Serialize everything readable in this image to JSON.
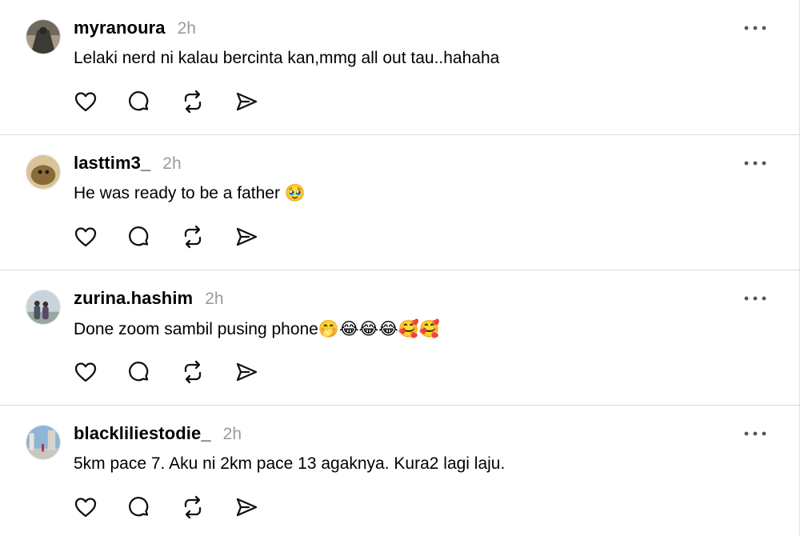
{
  "posts": [
    {
      "username": "myranoura",
      "time": "2h",
      "text": "Lelaki nerd ni kalau bercinta kan,mmg all out tau..hahaha",
      "avatar_colors": [
        "#3b3a34",
        "#a89a86"
      ]
    },
    {
      "username": "lasttim3_",
      "time": "2h",
      "text": "He was ready to be a father 🥹",
      "avatar_colors": [
        "#8a6a3a",
        "#d9c49a"
      ]
    },
    {
      "username": "zurina.hashim",
      "time": "2h",
      "text": "Done zoom sambil pusing phone🤭😂😂😂🥰🥰",
      "avatar_colors": [
        "#c9d3da",
        "#4a5560"
      ]
    },
    {
      "username": "blackliliestodie_",
      "time": "2h",
      "text": "5km pace 7. Aku ni 2km pace 13 agaknya. Kura2 lagi laju.",
      "avatar_colors": [
        "#8fb4d8",
        "#c8c8c0"
      ]
    }
  ],
  "icons": {
    "like": "heart-icon",
    "reply": "comment-icon",
    "repost": "repost-icon",
    "share": "send-icon",
    "more": "more-options-icon"
  },
  "colors": {
    "text": "#000000",
    "muted": "#9a9a9a",
    "divider": "#dcdcdc"
  }
}
